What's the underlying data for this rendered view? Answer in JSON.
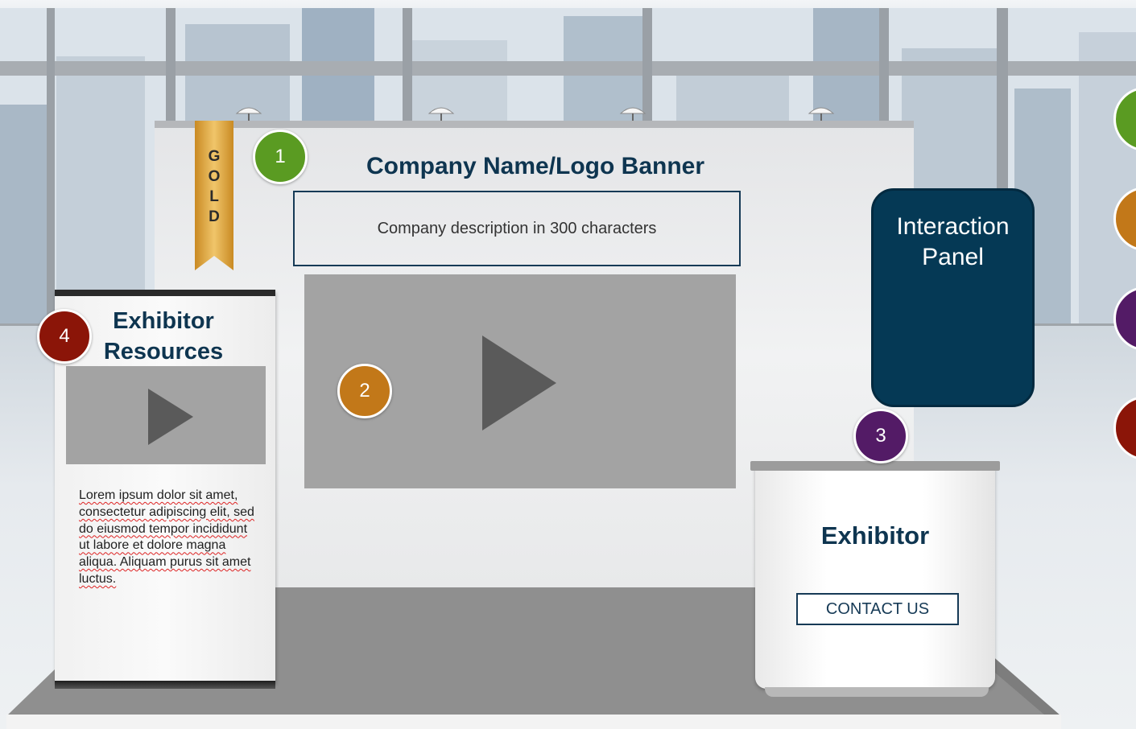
{
  "booth": {
    "tier_ribbon": [
      "G",
      "O",
      "L",
      "D"
    ],
    "banner_title": "Company Name/Logo Banner",
    "description": "Company description in 300 characters",
    "interaction_panel": [
      "Interaction",
      "Panel"
    ],
    "resources_title": [
      "Exhibitor",
      "Resources"
    ],
    "resources_text": "Lorem ipsum dolor sit amet, consectetur adipiscing elit, sed do eiusmod tempor incididunt ut labore et dolore magna aliqua. Aliquam purus sit amet luctus.",
    "counter_title": "Exhibitor",
    "contact_label": "CONTACT US"
  },
  "badges": [
    {
      "label": "1",
      "color": "#5a9b22"
    },
    {
      "label": "2",
      "color": "#c27819"
    },
    {
      "label": "3",
      "color": "#531b66"
    },
    {
      "label": "4",
      "color": "#8b1508"
    }
  ],
  "colors": {
    "title_navy": "#0e3550",
    "panel_navy": "#053955",
    "video_gray": "#a3a3a3",
    "play_gray": "#5a5a5a",
    "ribbon_gold": "#d9a03a",
    "floor_gray": "#8f8f8f"
  },
  "icons": {
    "main_video": "play-icon",
    "resource_video": "play-icon",
    "ribbon": "gold-ribbon-icon"
  }
}
